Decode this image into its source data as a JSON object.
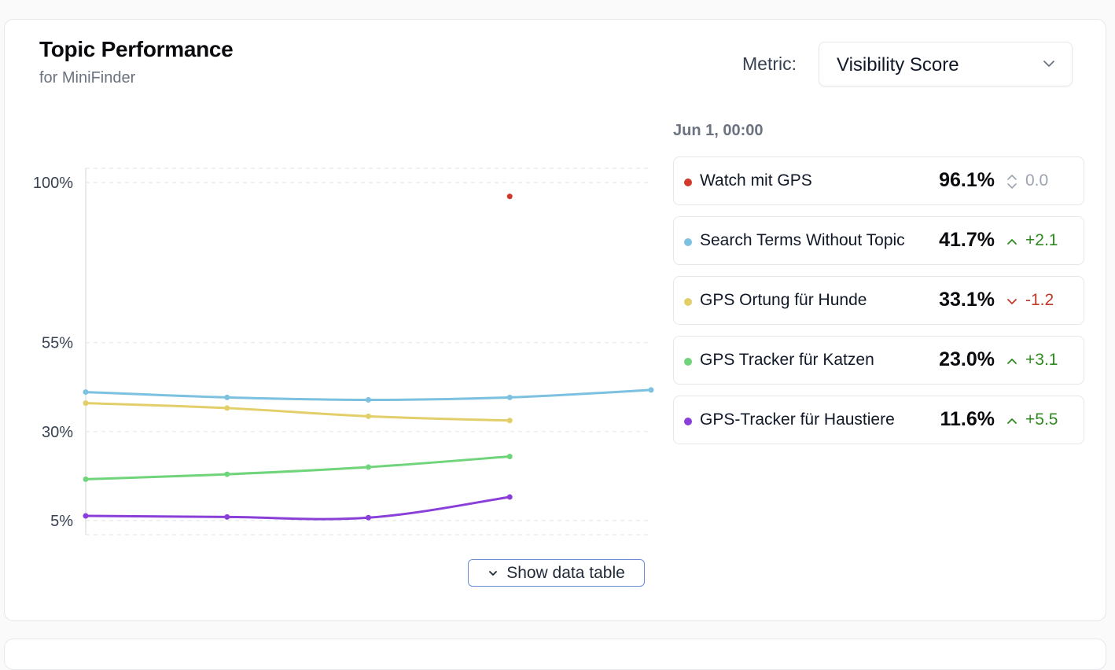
{
  "header": {
    "title": "Topic Performance",
    "subtitle": "for MiniFinder"
  },
  "metric": {
    "label": "Metric:",
    "selected": "Visibility Score"
  },
  "show_table_label": "Show data table",
  "tooltip": {
    "date": "Jun 1, 00:00",
    "rows": [
      {
        "name": "Watch mit GPS",
        "value": "96.1%",
        "change": "0.0",
        "trend": "neutral",
        "color": "#d0392b"
      },
      {
        "name": "Search Terms Without Topic",
        "value": "41.7%",
        "change": "+2.1",
        "trend": "up",
        "color": "#7cc1e0"
      },
      {
        "name": "GPS Ortung für Hunde",
        "value": "33.1%",
        "change": "-1.2",
        "trend": "down",
        "color": "#e3cf6a"
      },
      {
        "name": "GPS Tracker für Katzen",
        "value": "23.0%",
        "change": "+3.1",
        "trend": "up",
        "color": "#6fd47a"
      },
      {
        "name": "GPS-Tracker für Haustiere",
        "value": "11.6%",
        "change": "+5.5",
        "trend": "up",
        "color": "#8b3fd9"
      }
    ]
  },
  "chart_data": {
    "type": "line",
    "x": [
      0,
      1,
      2,
      3,
      4
    ],
    "y_ticks": [
      "100%",
      "55%",
      "30%",
      "5%"
    ],
    "y_tick_values": [
      100,
      55,
      30,
      5
    ],
    "ylim": [
      1,
      104
    ],
    "grid": true,
    "series": [
      {
        "name": "Watch mit GPS",
        "color": "#d0392b",
        "values": [
          null,
          null,
          null,
          96.1,
          null
        ]
      },
      {
        "name": "Search Terms Without Topic",
        "color": "#7cc1e0",
        "values": [
          41.1,
          39.6,
          38.9,
          39.6,
          41.7
        ]
      },
      {
        "name": "GPS Ortung für Hunde",
        "color": "#e3cf6a",
        "values": [
          38.0,
          36.6,
          34.3,
          33.1,
          null
        ]
      },
      {
        "name": "GPS Tracker für Katzen",
        "color": "#6fd47a",
        "values": [
          16.6,
          18.0,
          20.0,
          23.0,
          null
        ]
      },
      {
        "name": "GPS-Tracker für Haustiere",
        "color": "#8b3fd9",
        "values": [
          6.3,
          6.0,
          5.8,
          11.6,
          null
        ]
      }
    ]
  }
}
